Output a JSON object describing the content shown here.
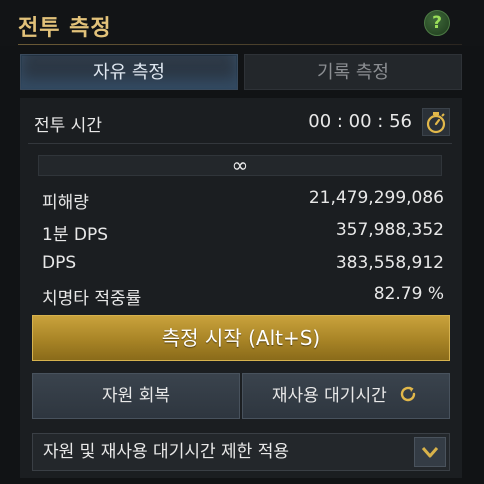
{
  "header": {
    "title": "전투 측정",
    "help_label": "?"
  },
  "tabs": [
    {
      "label": "자유 측정",
      "active": true
    },
    {
      "label": "기록 측정",
      "active": false
    }
  ],
  "battle_time": {
    "label": "전투 시간",
    "value": "00 : 00 : 56",
    "icon": "stopwatch-icon"
  },
  "progress": {
    "label": "∞"
  },
  "stats": [
    {
      "label": "피해량",
      "value": "21,479,299,086"
    },
    {
      "label": "1분 DPS",
      "value": "357,988,352"
    },
    {
      "label": "DPS",
      "value": "383,558,912"
    },
    {
      "label": "치명타 적중률",
      "value": "82.79 %"
    }
  ],
  "buttons": {
    "start": "측정 시작 (Alt+S)",
    "restore": "자원 회복",
    "cooldown": "재사용 대기시간",
    "cooldown_icon": "refresh-icon"
  },
  "dropdown": {
    "selected": "자원 및 재사용 대기시간 제한 적용",
    "icon": "chevron-down-icon"
  },
  "colors": {
    "accent_gold": "#c9a23c",
    "title_gold": "#e2c27a",
    "help_green": "#9be05a"
  }
}
